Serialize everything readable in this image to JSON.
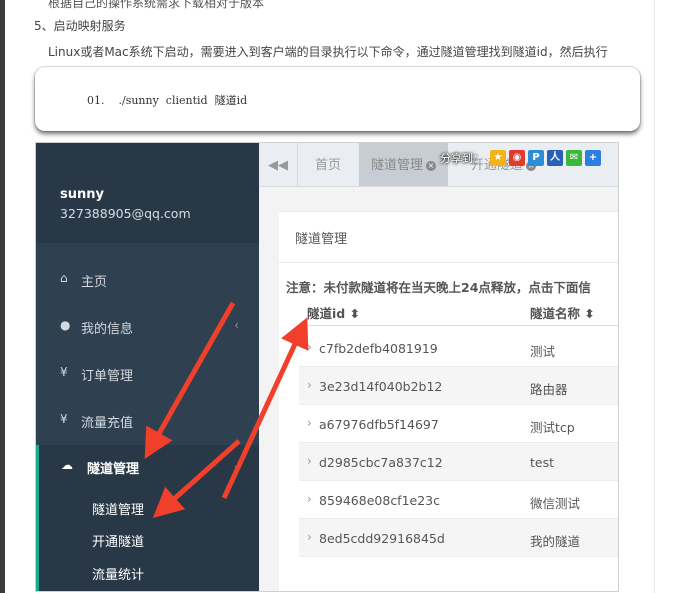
{
  "intro_line": "根据自己的操作系统需求下载相对于版本",
  "step_title": "5、启动映射服务",
  "step_desc": "Linux或者Mac系统下启动，需要进入到客户端的目录执行以下命令，通过隧道管理找到隧道id，然后执行",
  "code": {
    "line_number": "01.",
    "command": "./sunny  clientid  隧道id"
  },
  "app": {
    "user": {
      "name": "sunny",
      "email": "327388905@qq.com"
    },
    "nav": [
      {
        "label": "主页",
        "icon": "home-icon",
        "glyph": "🏠"
      },
      {
        "label": "我的信息",
        "icon": "user-icon",
        "glyph": "👤"
      },
      {
        "label": "订单管理",
        "icon": "yen-icon",
        "glyph": "¥"
      },
      {
        "label": "流量充值",
        "icon": "yen-icon",
        "glyph": "¥"
      },
      {
        "label": "隧道管理",
        "icon": "cloud-icon",
        "glyph": "☁"
      }
    ],
    "subnav": [
      "隧道管理",
      "开通隧道",
      "流量统计"
    ],
    "tabs": {
      "back": "◀◀",
      "home": "首页",
      "active": "隧道管理",
      "third": "开通隧道"
    },
    "share": {
      "label": "分享到："
    },
    "panel_title": "隧道管理",
    "notice": "注意：未付款隧道将在当天晚上24点释放，点击下面信",
    "columns": [
      "隧道id ⬍",
      "隧道名称 ⬍"
    ],
    "rows": [
      {
        "id": "c7fb2defb4081919",
        "name": "测试"
      },
      {
        "id": "3e23d14f040b2b12",
        "name": "路由器"
      },
      {
        "id": "a67976dfb5f14697",
        "name": "测试tcp"
      },
      {
        "id": "d2985cbc7a837c12",
        "name": "test"
      },
      {
        "id": "859468e08cf1e23c",
        "name": "微信测试"
      },
      {
        "id": "8ed5cdd92916845d",
        "name": "我的隧道"
      }
    ]
  },
  "colors": {
    "sidebar": "#2f4050",
    "accent": "#19aa8d",
    "arrow": "#f0402c"
  }
}
